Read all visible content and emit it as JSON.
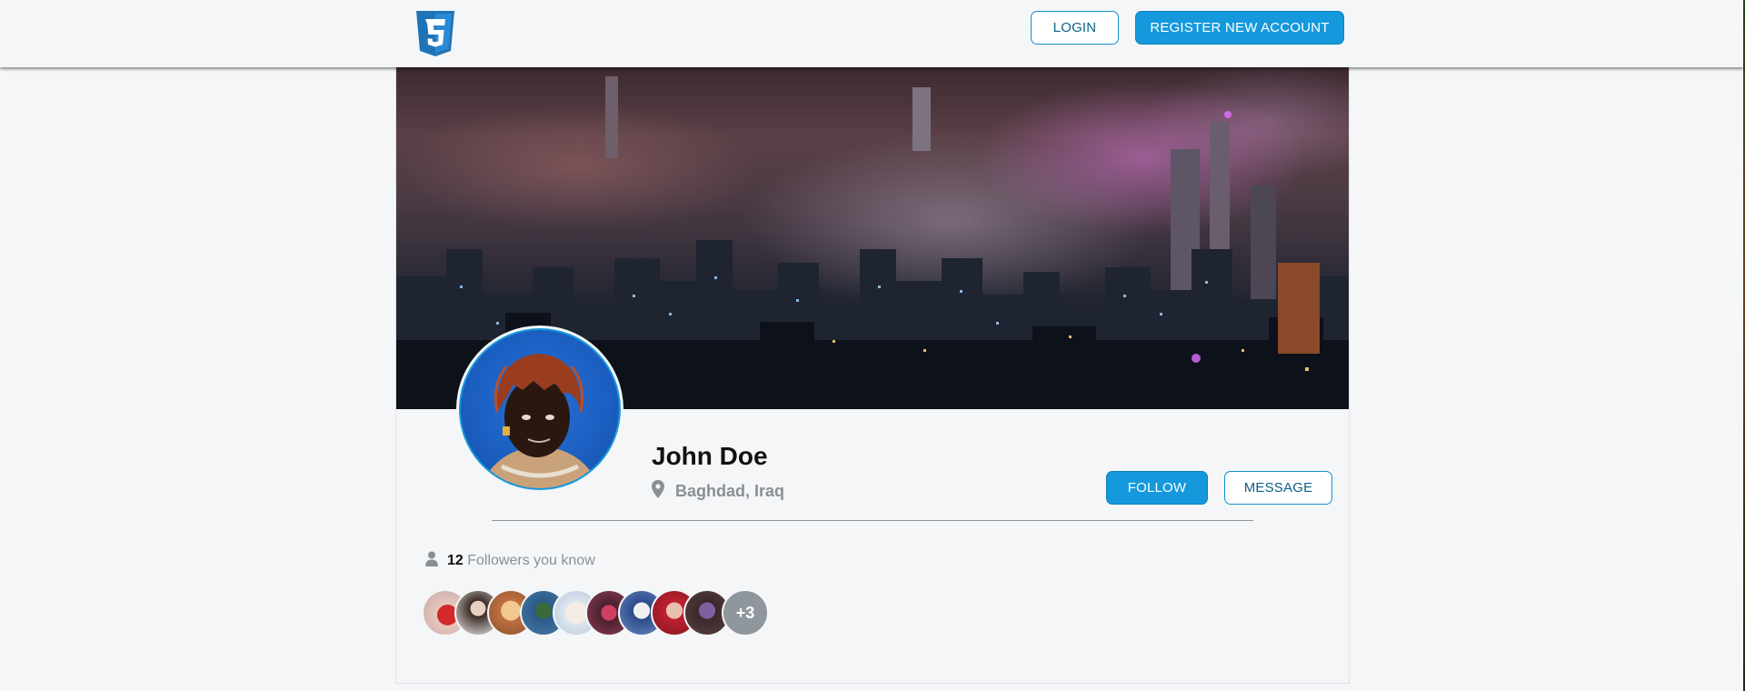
{
  "header": {
    "logo_icon": "css3-shield-icon",
    "login_label": "LOGIN",
    "register_label": "REGISTER NEW ACCOUNT"
  },
  "profile": {
    "name": "John Doe",
    "location": "Baghdad, Iraq",
    "location_icon": "map-pin-icon",
    "follow_label": "FOLLOW",
    "message_label": "MESSAGE"
  },
  "followers": {
    "icon": "user-icon",
    "count": "12",
    "text": "Followers you know",
    "more_label": "+3"
  },
  "colors": {
    "accent": "#1599dc",
    "page_bg": "#f4f6f8",
    "muted_text": "#8a8f96"
  }
}
